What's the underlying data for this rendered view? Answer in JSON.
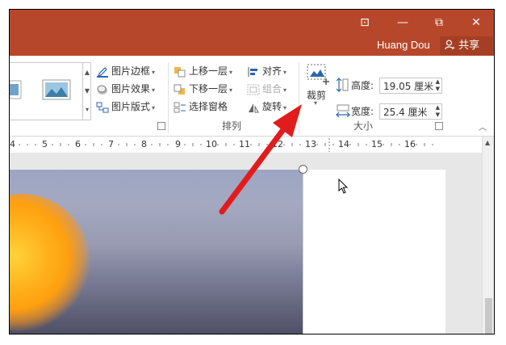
{
  "titlebar": {
    "restore_icon": "⊡",
    "minimize_icon": "—",
    "maximize_icon": "⧉",
    "close_icon": "✕",
    "user_name": "Huang Dou",
    "share_label": "共享"
  },
  "ribbon": {
    "arrange": {
      "picture_border": "图片边框",
      "picture_effects": "图片效果",
      "picture_layout": "图片版式",
      "bring_forward": "上移一层",
      "send_backward": "下移一层",
      "selection_pane": "选择窗格",
      "align": "对齐",
      "group": "组合",
      "rotate": "旋转",
      "group_label": "排列"
    },
    "size": {
      "crop_label": "裁剪",
      "height_label": "高度:",
      "height_value": "19.05 厘米",
      "width_label": "宽度:",
      "width_value": "25.4 厘米",
      "group_label": "大小"
    }
  },
  "ruler": {
    "ticks": [
      "4",
      "5",
      "6",
      "7",
      "8",
      "9",
      "10",
      "11",
      "12",
      "13",
      "14",
      "15",
      "16"
    ]
  },
  "colors": {
    "titlebar": "#b7472a",
    "share_bg": "#a43f25",
    "arrow": "#e11c1c"
  }
}
